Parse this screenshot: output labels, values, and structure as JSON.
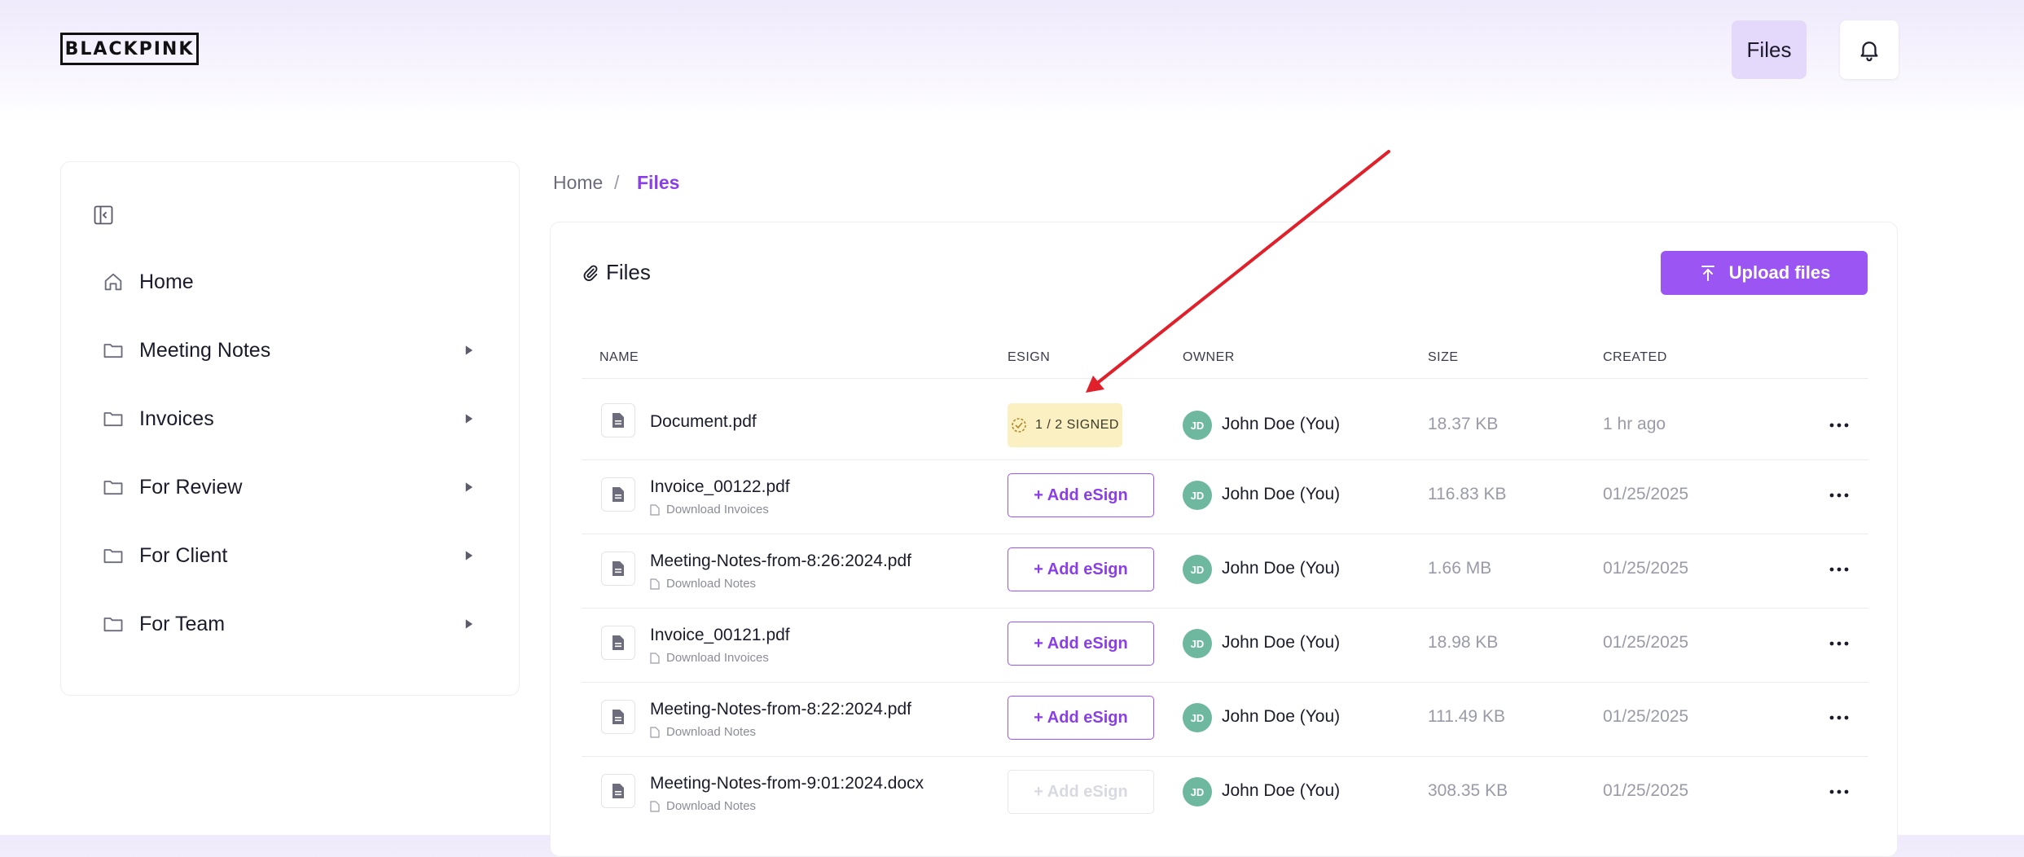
{
  "header": {
    "logo_text": "BLACKPINK",
    "files_button": "Files",
    "bell_icon": "bell-icon"
  },
  "sidebar": {
    "collapse_icon": "sidebar-collapse-icon",
    "items": [
      {
        "label": "Home",
        "icon": "home-icon",
        "has_caret": false
      },
      {
        "label": "Meeting Notes",
        "icon": "folder-icon",
        "has_caret": true
      },
      {
        "label": "Invoices",
        "icon": "folder-icon",
        "has_caret": true
      },
      {
        "label": "For Review",
        "icon": "folder-icon",
        "has_caret": true
      },
      {
        "label": "For Client",
        "icon": "folder-icon",
        "has_caret": true
      },
      {
        "label": "For Team",
        "icon": "folder-icon",
        "has_caret": true
      }
    ]
  },
  "breadcrumb": {
    "home": "Home",
    "separator": "/",
    "current": "Files"
  },
  "main": {
    "title": "Files",
    "title_icon": "paperclip-icon",
    "upload_button": "Upload files",
    "columns": [
      "NAME",
      "ESIGN",
      "OWNER",
      "SIZE",
      "CREATED"
    ],
    "rows": [
      {
        "name": "Document.pdf",
        "sub": "",
        "esign": "1 / 2 SIGNED",
        "esign_state": "signed",
        "owner_initials": "JD",
        "owner": "John Doe (You)",
        "size": "18.37 KB",
        "created": "1 hr ago"
      },
      {
        "name": "Invoice_00122.pdf",
        "sub": "Download Invoices",
        "esign": "+ Add eSign",
        "esign_state": "active",
        "owner_initials": "JD",
        "owner": "John Doe (You)",
        "size": "116.83 KB",
        "created": "01/25/2025"
      },
      {
        "name": "Meeting-Notes-from-8:26:2024.pdf",
        "sub": "Download Notes",
        "esign": "+ Add eSign",
        "esign_state": "active",
        "owner_initials": "JD",
        "owner": "John Doe (You)",
        "size": "1.66 MB",
        "created": "01/25/2025"
      },
      {
        "name": "Invoice_00121.pdf",
        "sub": "Download Invoices",
        "esign": "+ Add eSign",
        "esign_state": "active",
        "owner_initials": "JD",
        "owner": "John Doe (You)",
        "size": "18.98 KB",
        "created": "01/25/2025"
      },
      {
        "name": "Meeting-Notes-from-8:22:2024.pdf",
        "sub": "Download Notes",
        "esign": "+ Add eSign",
        "esign_state": "active",
        "owner_initials": "JD",
        "owner": "John Doe (You)",
        "size": "111.49 KB",
        "created": "01/25/2025"
      },
      {
        "name": "Meeting-Notes-from-9:01:2024.docx",
        "sub": "Download Notes",
        "esign": "+ Add eSign",
        "esign_state": "disabled",
        "owner_initials": "JD",
        "owner": "John Doe (You)",
        "size": "308.35 KB",
        "created": "01/25/2025"
      }
    ]
  },
  "colors": {
    "accent": "#9b55f2",
    "annotation_arrow": "#e0202a",
    "signed_badge_bg": "#fbf0c2",
    "avatar_bg": "#6fb8a0"
  }
}
